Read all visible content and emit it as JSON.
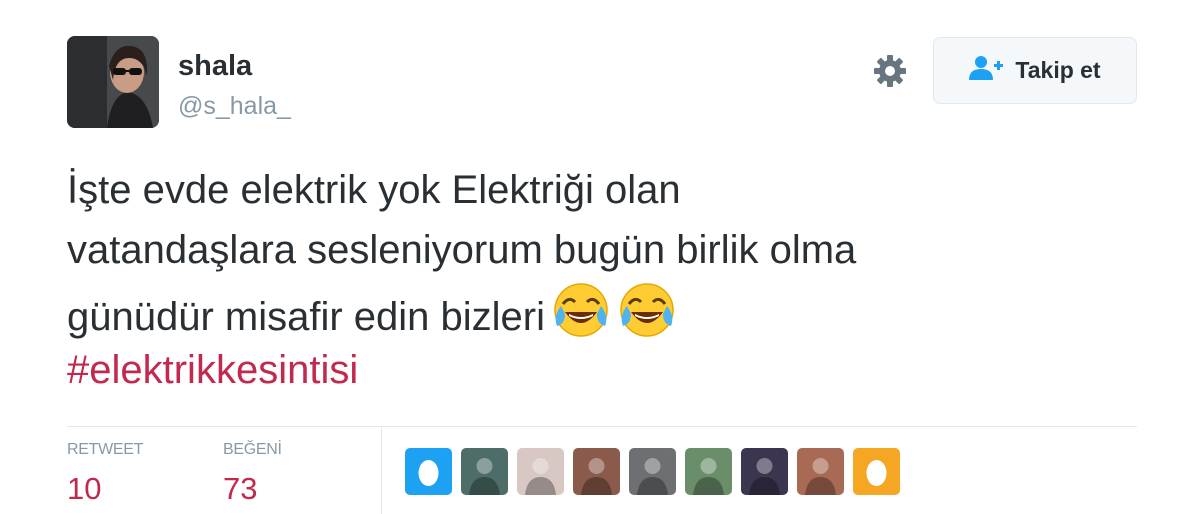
{
  "user": {
    "display_name": "shala",
    "handle": "@s_hala_"
  },
  "actions": {
    "follow_label": "Takip et",
    "settings_icon": "gear-icon",
    "follow_icon": "person-add-icon"
  },
  "tweet": {
    "lines": [
      "İşte evde elektrik yok Elektriği olan",
      "vatandaşlara sesleniyorum bugün birlik olma",
      "günüdür misafir edin bizleri"
    ],
    "emojis": [
      "face-with-tears-of-joy-emoji",
      "face-with-tears-of-joy-emoji"
    ],
    "hashtag": "#elektrikkesintisi"
  },
  "stats": {
    "retweet_label": "RETWEET",
    "retweet_count": "10",
    "like_label": "BEĞENİ",
    "like_count": "73"
  },
  "likers": [
    {
      "kind": "default-egg-avatar",
      "color": "#1da1f2"
    },
    {
      "kind": "photo-avatar",
      "color": "#4d6d69"
    },
    {
      "kind": "photo-avatar",
      "color": "#d9c7c4"
    },
    {
      "kind": "photo-avatar",
      "color": "#8a5a4a"
    },
    {
      "kind": "photo-avatar",
      "color": "#6d6f72"
    },
    {
      "kind": "photo-avatar",
      "color": "#6a8e6a"
    },
    {
      "kind": "photo-avatar",
      "color": "#3b3550"
    },
    {
      "kind": "photo-avatar",
      "color": "#a86a55"
    },
    {
      "kind": "default-egg-avatar",
      "color": "#f5a623"
    }
  ],
  "colors": {
    "text": "#292f33",
    "muted": "#8899a6",
    "accent": "#c2294e",
    "follow_icon": "#1da1f2",
    "border": "#e1e8ed"
  }
}
